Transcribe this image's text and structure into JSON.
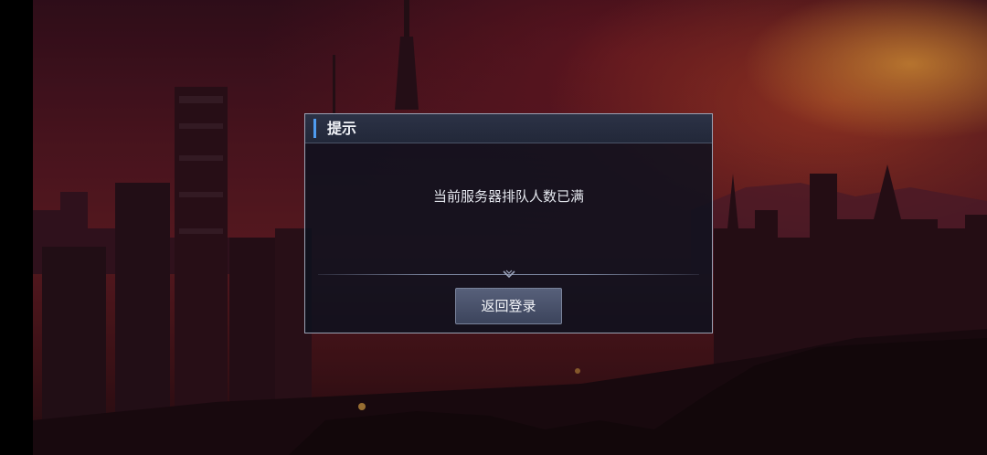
{
  "dialog": {
    "title": "提示",
    "message": "当前服务器排队人数已满",
    "button_label": "返回登录"
  },
  "colors": {
    "accent": "#4f9cf0",
    "dialog_border": "#9aa1b3",
    "button": "#4a5370"
  },
  "icons": {
    "divider": "chevron-down-ornament-icon"
  }
}
